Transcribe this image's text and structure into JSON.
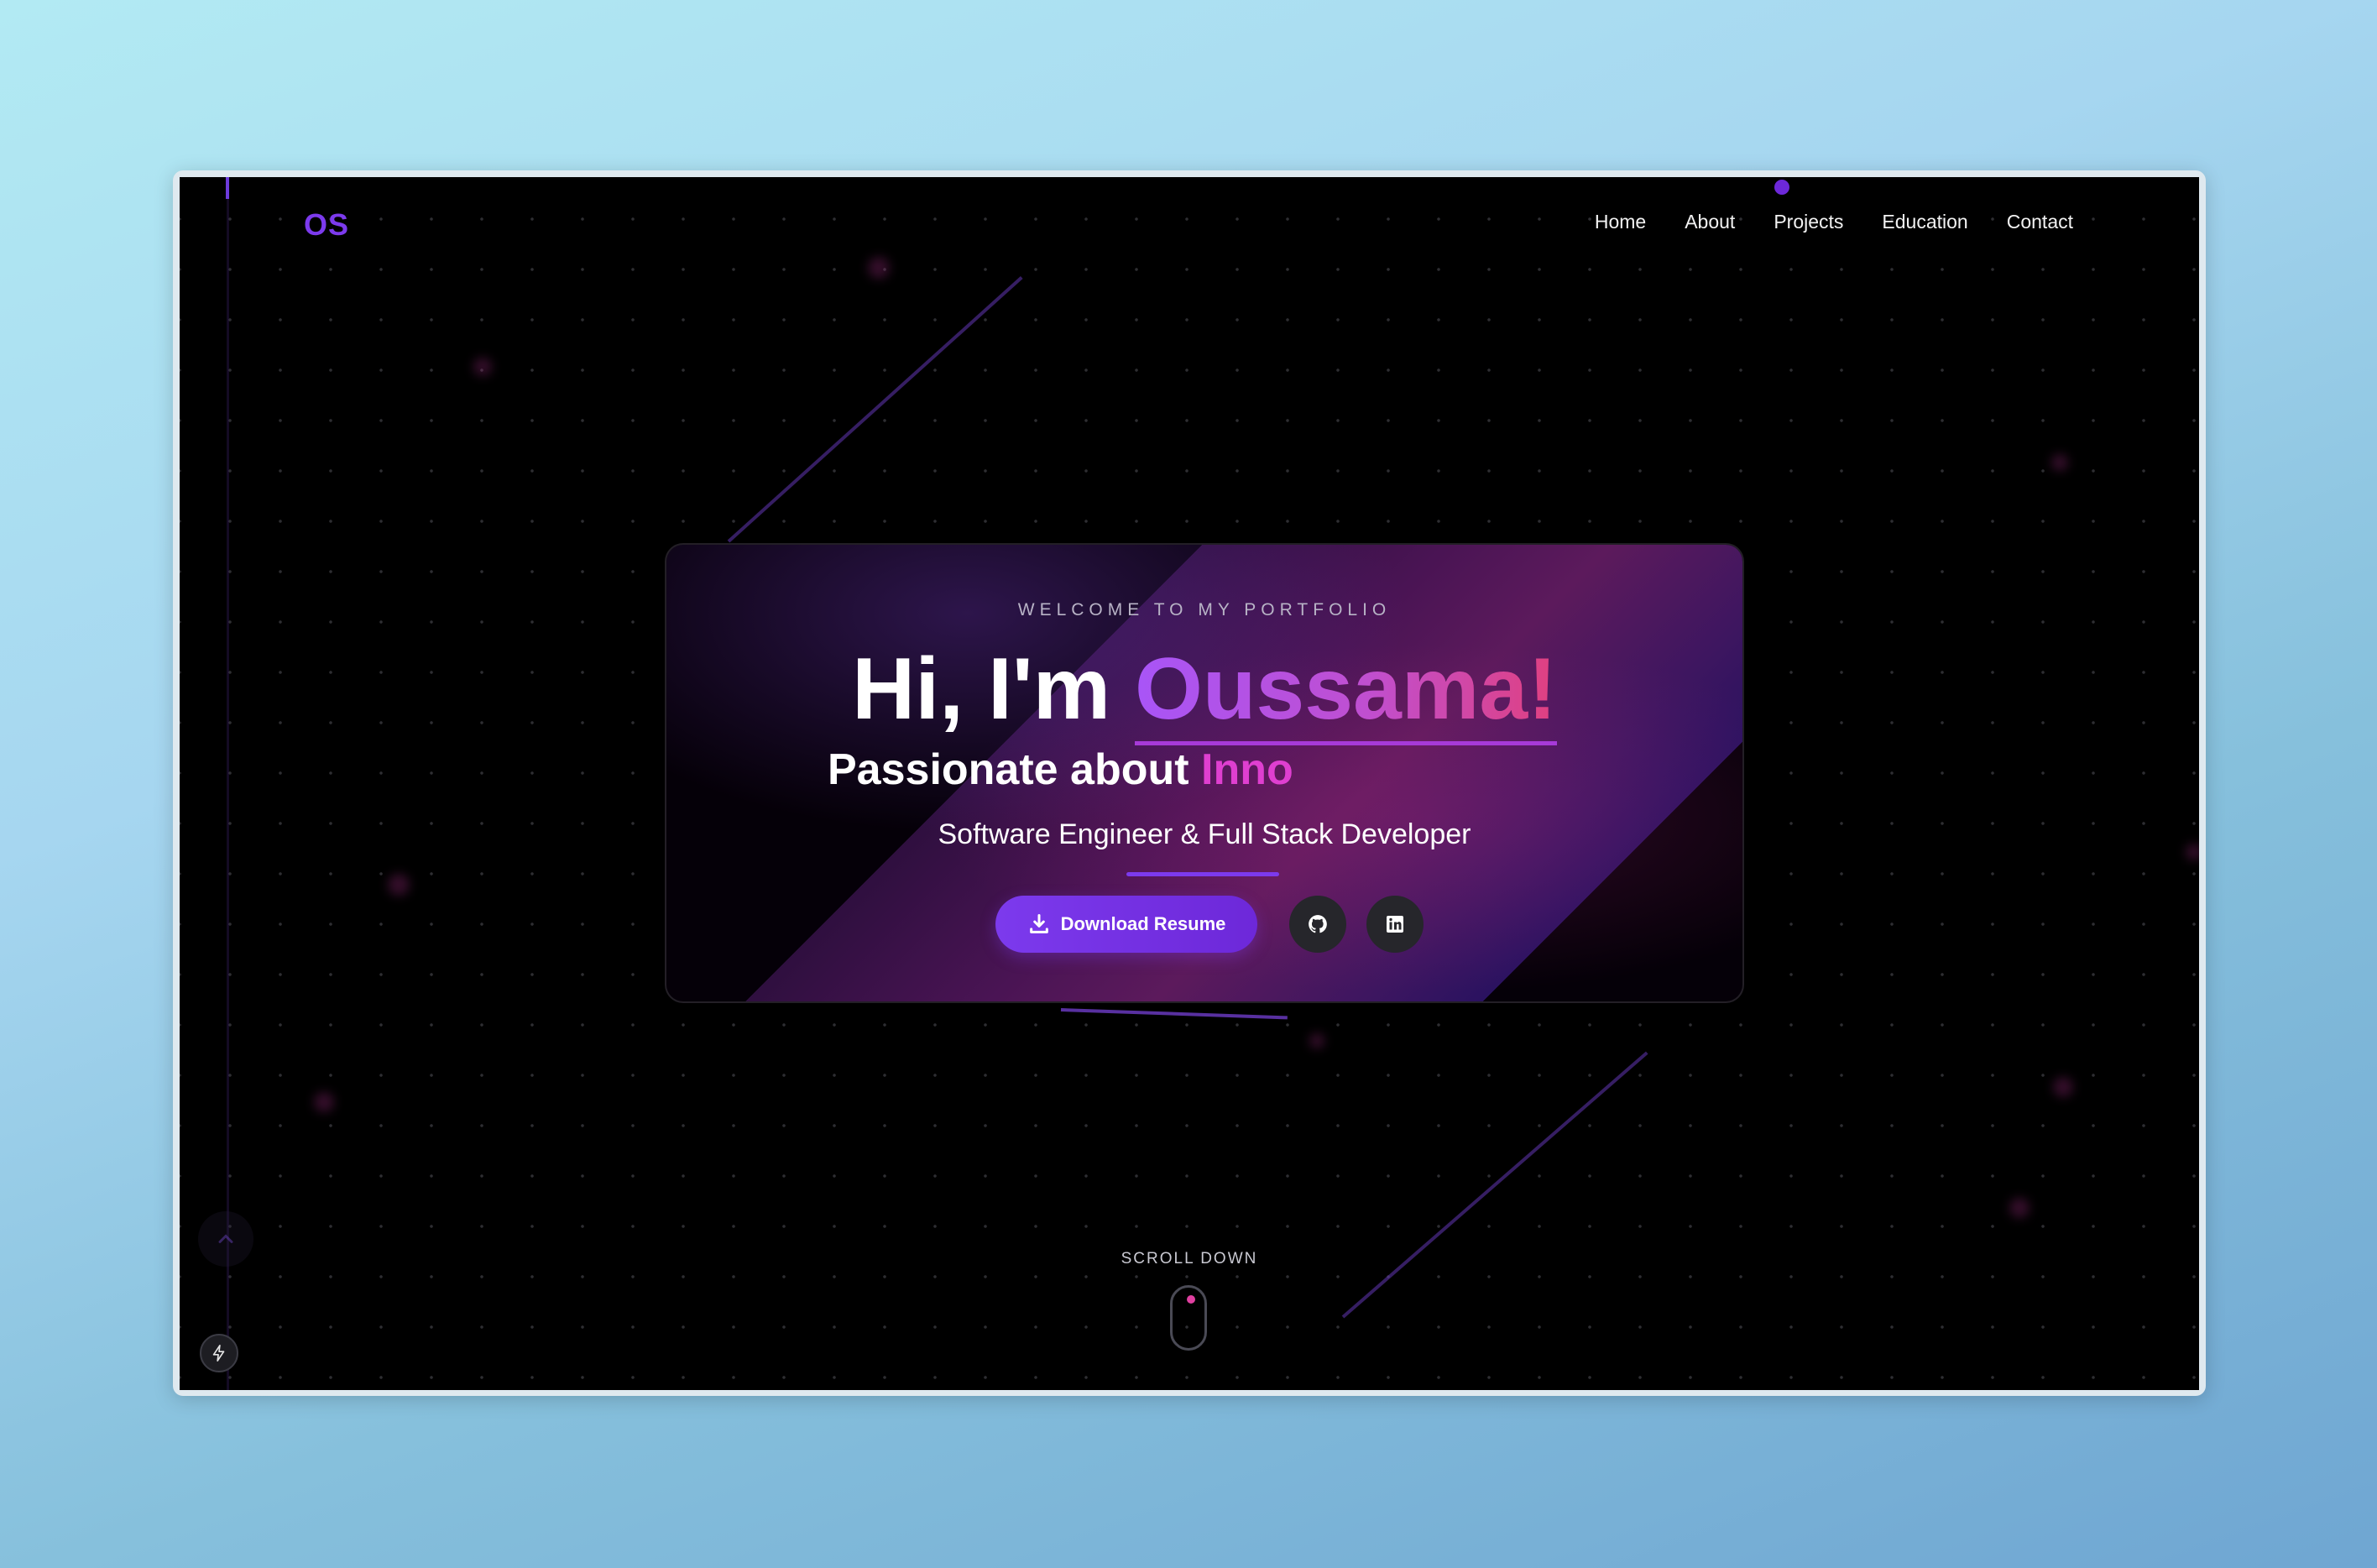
{
  "header": {
    "logo": "OS",
    "nav": [
      "Home",
      "About",
      "Projects",
      "Education",
      "Contact"
    ]
  },
  "hero": {
    "welcome": "WELCOME TO MY PORTFOLIO",
    "greeting_prefix": "Hi, I'm ",
    "name": "Oussama!",
    "passion_prefix": "Passionate about ",
    "passion_typed": "Inno",
    "role": "Software Engineer & Full Stack Developer",
    "resume_button": "Download Resume",
    "icons": [
      "download-icon",
      "github-icon",
      "linkedin-icon"
    ]
  },
  "scroll": {
    "label": "SCROLL DOWN"
  },
  "colors": {
    "accent": "#7c3aed",
    "pink": "#df3fd0",
    "background": "#000000"
  }
}
